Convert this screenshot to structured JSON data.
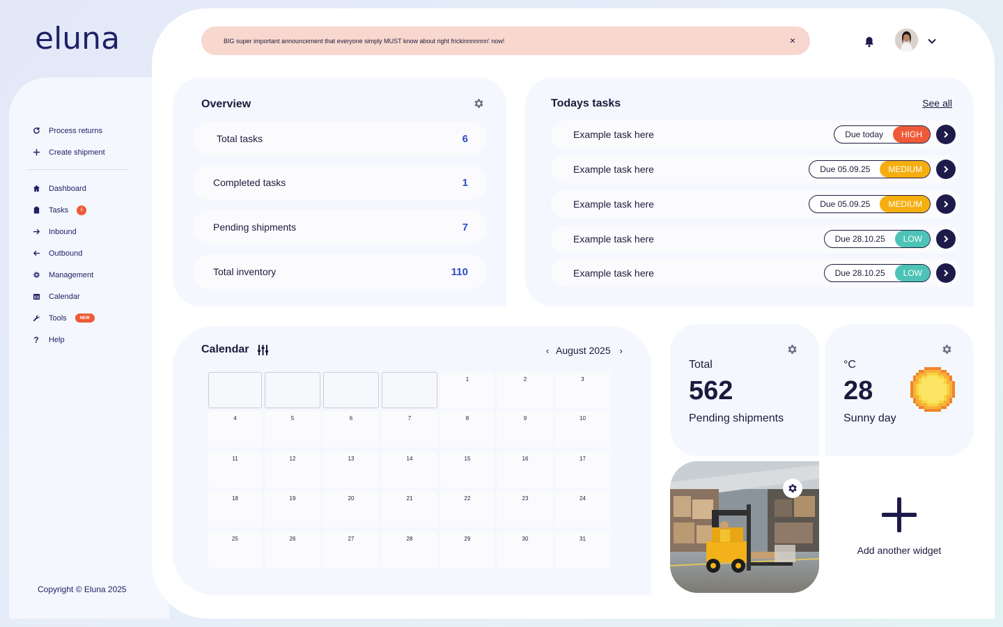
{
  "brand": {
    "name": "eluna",
    "accent": "#ee5a37",
    "primary": "#1e2166"
  },
  "sidebar": {
    "quick_actions": [
      {
        "label": "Process returns",
        "icon": "refresh-icon"
      },
      {
        "label": "Create shipment",
        "icon": "plus-icon"
      }
    ],
    "items": [
      {
        "label": "Dashboard",
        "icon": "home-icon"
      },
      {
        "label": "Tasks",
        "icon": "clipboard-icon",
        "badge": "5"
      },
      {
        "label": "Inbound",
        "icon": "arrow-right-icon"
      },
      {
        "label": "Outbound",
        "icon": "arrow-left-icon"
      },
      {
        "label": "Management",
        "icon": "gear-icon"
      },
      {
        "label": "Calendar",
        "icon": "calendar-icon"
      },
      {
        "label": "Tools",
        "icon": "wrench-icon",
        "badge": "NEW"
      },
      {
        "label": "Help",
        "icon": "question-icon"
      }
    ],
    "copyright": "Copyright © Eluna 2025"
  },
  "announcement": {
    "text": "BIG super important announcement that everyone simply MUST know about right frickinnnnnnn' now!",
    "close": "×"
  },
  "overview": {
    "title": "Overview",
    "rows": [
      {
        "label": "Total tasks",
        "value": "6"
      },
      {
        "label": "Completed tasks",
        "value": "1"
      },
      {
        "label": "Pending shipments",
        "value": "7"
      },
      {
        "label": "Total inventory",
        "value": "110"
      }
    ]
  },
  "tasks": {
    "title": "Todays tasks",
    "see_all": "See all",
    "rows": [
      {
        "label": "Example task here",
        "due": "Due today",
        "priority": "HIGH",
        "color": "#ee5a37"
      },
      {
        "label": "Example task here",
        "due": "Due 05.09.25",
        "priority": "MEDIUM",
        "color": "#f6ae0f"
      },
      {
        "label": "Example task here",
        "due": "Due 05.09.25",
        "priority": "MEDIUM",
        "color": "#f6ae0f"
      },
      {
        "label": "Example task here",
        "due": "Due 28.10.25",
        "priority": "LOW",
        "color": "#4cc3b6"
      },
      {
        "label": "Example task here",
        "due": "Due 28.10.25",
        "priority": "LOW",
        "color": "#4cc3b6"
      }
    ]
  },
  "calendar": {
    "title": "Calendar",
    "month": "August 2025",
    "prev": "‹",
    "next": "›",
    "leading_blank_days": 4,
    "days": [
      "1",
      "2",
      "3",
      "4",
      "5",
      "6",
      "7",
      "8",
      "9",
      "10",
      "11",
      "12",
      "13",
      "14",
      "15",
      "16",
      "17",
      "18",
      "19",
      "20",
      "21",
      "22",
      "23",
      "24",
      "25",
      "26",
      "27",
      "28",
      "29",
      "30",
      "31"
    ]
  },
  "widgets": {
    "shipments": {
      "label": "Total",
      "value": "562",
      "sub": "Pending shipments"
    },
    "weather": {
      "label": "°C",
      "value": "28",
      "sub": "Sunny day"
    },
    "add": {
      "label": "Add another widget"
    }
  }
}
